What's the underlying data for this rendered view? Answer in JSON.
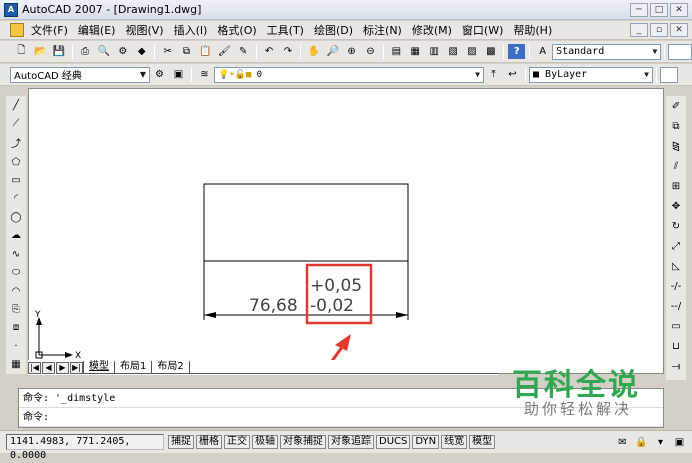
{
  "window": {
    "title": "AutoCAD 2007 - [Drawing1.dwg]"
  },
  "menu": {
    "items": [
      "文件(F)",
      "编辑(E)",
      "视图(V)",
      "插入(I)",
      "格式(O)",
      "工具(T)",
      "绘图(D)",
      "标注(N)",
      "修改(M)",
      "窗口(W)",
      "帮助(H)"
    ]
  },
  "toolbar": {
    "text_style": "Standard",
    "workspace": "AutoCAD 经典",
    "layer": "0",
    "color_control": "ByLayer"
  },
  "drawing": {
    "dim_main": "76,68",
    "tol_plus": "+0,05",
    "tol_minus": "-0,02",
    "ucs_x": "X",
    "ucs_y": "Y",
    "highlight_color": "#e03a30"
  },
  "layout_tabs": [
    "模型",
    "布局1",
    "布局2"
  ],
  "command": {
    "line1": "命令: '_dimstyle",
    "line2": "命令:"
  },
  "status": {
    "coords": "1141.4983, 771.2405, 0.0000",
    "buttons": [
      "捕捉",
      "栅格",
      "正交",
      "极轴",
      "对象捕捉",
      "对象追踪",
      "DUCS",
      "DYN",
      "线宽",
      "模型"
    ]
  },
  "watermark": {
    "title": "百科全说",
    "subtitle": "助你轻松解决"
  },
  "icons": {
    "left_strip": [
      "line-icon",
      "construction-line-icon",
      "polyline-icon",
      "polygon-icon",
      "rectangle-icon",
      "arc-icon",
      "circle-icon",
      "revision-cloud-icon",
      "spline-icon",
      "ellipse-icon",
      "ellipse-arc-icon",
      "insert-block-icon",
      "make-block-icon",
      "point-icon",
      "hatch-icon"
    ],
    "right_strip": [
      "erase-icon",
      "copy-icon",
      "mirror-icon",
      "offset-icon",
      "array-icon",
      "move-icon",
      "rotate-icon",
      "scale-icon",
      "stretch-icon",
      "trim-icon",
      "extend-icon",
      "break-icon",
      "join-icon",
      "chamfer-icon"
    ]
  }
}
